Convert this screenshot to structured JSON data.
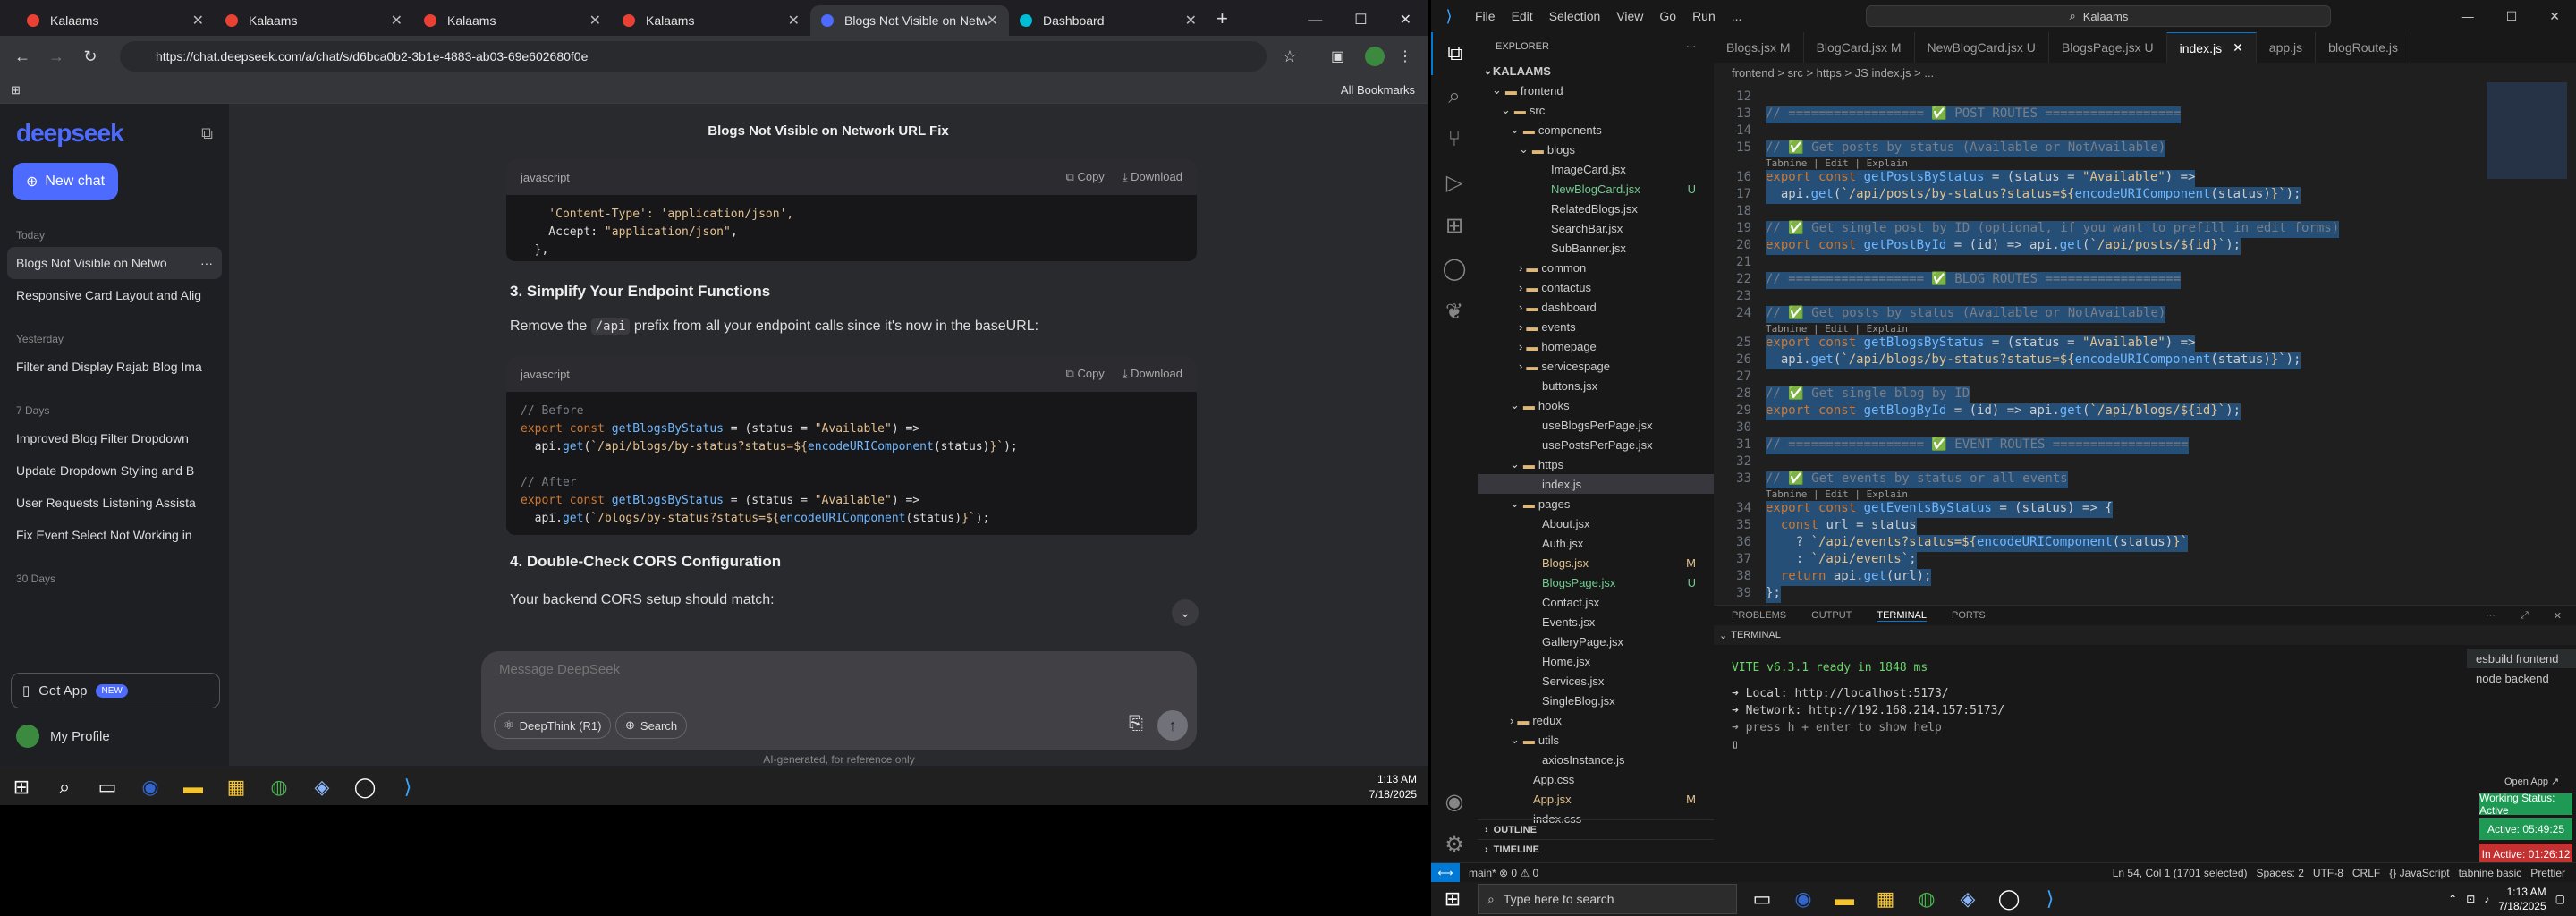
{
  "browser": {
    "tabs": [
      {
        "label": "Kalaams"
      },
      {
        "label": "Kalaams"
      },
      {
        "label": "Kalaams"
      },
      {
        "label": "Kalaams"
      },
      {
        "label": "Blogs Not Visible on Netwo"
      },
      {
        "label": "Dashboard"
      }
    ],
    "url": "https://chat.deepseek.com/a/chat/s/d6bca0b2-3b1e-4883-ab03-69e602680f0e",
    "bookmarks": "All Bookmarks"
  },
  "deepseek": {
    "logo": "deepseek",
    "new_chat": "New chat",
    "today": "Today",
    "yesterday": "Yesterday",
    "days7": "7 Days",
    "days30": "30 Days",
    "today_items": [
      "Blogs Not Visible on Netwo",
      "Responsive Card Layout and Alig"
    ],
    "yesterday_items": [
      "Filter and Display Rajab Blog Ima"
    ],
    "week_items": [
      "Improved Blog Filter Dropdown",
      "Update Dropdown Styling and B",
      "User Requests Listening Assista",
      "Fix Event Select Not Working in"
    ],
    "get_app": "Get App",
    "badge": "NEW",
    "profile": "My Profile",
    "chat_title": "Blogs Not Visible on Network URL Fix",
    "lang": "javascript",
    "copy": "Copy",
    "download": "Download",
    "h3": "3. Simplify Your Endpoint Functions",
    "p3a": "Remove the",
    "p3code": "/api",
    "p3b": "prefix from all your endpoint calls since it's now in the baseURL:",
    "h4": "4. Double-Check CORS Configuration",
    "p4": "Your backend CORS setup should match:",
    "placeholder": "Message DeepSeek",
    "deepthink": "DeepThink (R1)",
    "search": "Search",
    "footer": "AI-generated, for reference only"
  },
  "taskbar1": {
    "time": "1:13 AM",
    "date": "7/18/2025"
  },
  "vscode": {
    "menu": [
      "File",
      "Edit",
      "Selection",
      "View",
      "Go",
      "Run",
      "..."
    ],
    "search": "Kalaams",
    "explorer_title": "EXPLORER",
    "root": "KALAAMS",
    "tabs": [
      {
        "label": "Blogs.jsx M"
      },
      {
        "label": "BlogCard.jsx M"
      },
      {
        "label": "NewBlogCard.jsx U"
      },
      {
        "label": "BlogsPage.jsx U"
      },
      {
        "label": "index.js"
      },
      {
        "label": "app.js"
      },
      {
        "label": "blogRoute.js"
      }
    ],
    "breadcrumb": "frontend > src > https > JS index.js > ...",
    "panel_tabs": [
      "PROBLEMS",
      "OUTPUT",
      "TERMINAL",
      "PORTS"
    ],
    "terminal_label": "TERMINAL",
    "term": [
      "VITE v6.3.1  ready in 1848 ms",
      "➜  Local:   http://localhost:5173/",
      "➜  Network: http://192.168.214.157:5173/",
      "➜  press h + enter to show help"
    ],
    "term_list": [
      "esbuild  frontend",
      "node  backend"
    ],
    "open_app": "Open App ↗",
    "working": "Working Status: Active",
    "active": "Active: 05:49:25",
    "inactive": "In Active: 01:26:12",
    "outline": "OUTLINE",
    "timeline": "TIMELINE",
    "status_left": "main*  ⊗ 0 ⚠ 0",
    "status_right": "Ln 54, Col 1 (1701 selected)   Spaces: 2   UTF-8   CRLF   {} JavaScript   tabnine basic   Prettier"
  },
  "taskbar2": {
    "search": "Type here to search",
    "time": "1:13 AM",
    "date": "7/18/2025"
  }
}
